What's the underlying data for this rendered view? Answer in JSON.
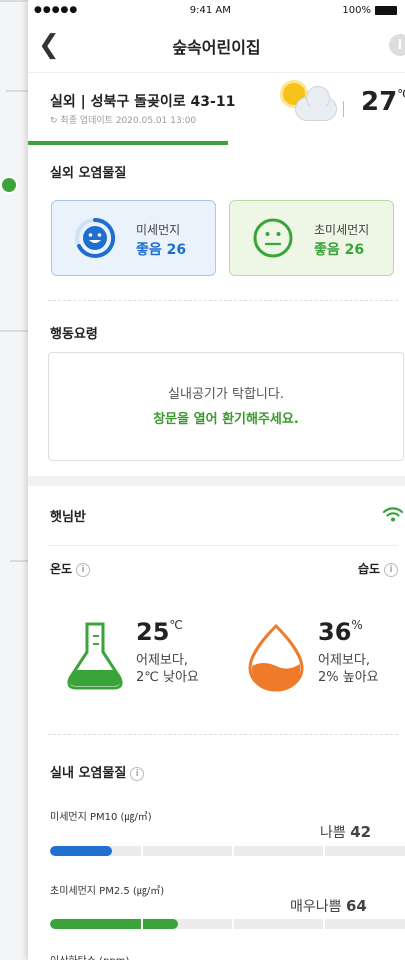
{
  "status_bar": {
    "signal": "●●●●● ",
    "time": "9:41 AM",
    "battery": "100%"
  },
  "nav": {
    "title": "숲속어린이집",
    "back_icon": "chevron-left-icon",
    "info_icon": "info-icon"
  },
  "location": {
    "title": "실외 | 성북구 돌곶이로 43-11",
    "updated": "최종 업데이트 2020.05.01 13:00",
    "weather_icon": "partly-cloudy-icon",
    "temp": "27",
    "temp_unit": "℃"
  },
  "outdoor": {
    "title": "실외 오염물질",
    "cards": [
      {
        "label": "미세먼지",
        "value": "좋음 26",
        "color": "#1f6fcf",
        "icon": "smile-face-icon"
      },
      {
        "label": "초미세먼지",
        "value": "좋음 26",
        "color": "#3aa33a",
        "icon": "neutral-face-icon"
      }
    ]
  },
  "action": {
    "title": "행동요령",
    "line1": "실내공기가 탁합니다.",
    "line2": "창문을 열어 환기해주세요."
  },
  "room": {
    "title": "햇님반",
    "wifi_icon": "wifi-icon",
    "temp_label": "온도",
    "humidity_label": "습도",
    "temp_value": "25",
    "temp_unit": "℃",
    "temp_cmp1": "어제보다,",
    "temp_cmp2": "2℃ 낮아요",
    "humidity_value": "36",
    "humidity_unit": "%",
    "humidity_cmp1": "어제보다,",
    "humidity_cmp2": "2% 높아요",
    "thermo_icon": "thermometer-flask-icon",
    "humidity_icon": "water-drop-icon"
  },
  "indoor": {
    "title": "실내 오염물질",
    "items": [
      {
        "label": "미세먼지 PM10 (㎍/㎥)",
        "status": "나쁨",
        "value": "42",
        "fill": 0.17,
        "color": "#1f6fcf"
      },
      {
        "label": "초미세먼지 PM2.5 (㎍/㎥)",
        "status": "매우나쁨",
        "value": "64",
        "fill": 0.35,
        "color": "#3aa33a"
      }
    ],
    "next_label": "이산화탄소 (ppm)"
  }
}
